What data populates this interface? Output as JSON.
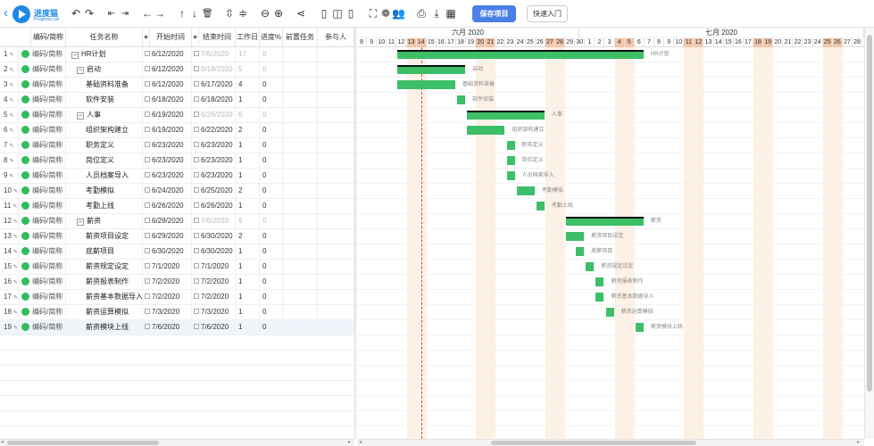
{
  "app": {
    "logo_title": "进度猫",
    "logo_subtitle": "Progress cat"
  },
  "toolbar": {
    "save_label": "保存项目",
    "quickstart_label": "快速入门",
    "icons": [
      "undo-icon",
      "redo-icon",
      "outdent-icon",
      "indent-icon",
      "move-left-icon",
      "move-right-icon",
      "move-up-icon",
      "move-down-icon",
      "delete-icon",
      "expand-all-icon",
      "collapse-all-icon",
      "zoom-out-icon",
      "zoom-in-icon",
      "critical-path-icon",
      "layout-grid-icon",
      "layout-both-icon",
      "layout-gantt-icon",
      "fullscreen-icon",
      "palette-icon",
      "members-icon",
      "print-icon",
      "download-icon",
      "excel-icon"
    ]
  },
  "columns": {
    "code": "编码/简称",
    "name": "任务名称",
    "start": "开始时间",
    "end": "结束时间",
    "workdays": "工作日",
    "progress": "进度%",
    "predecessor": "前置任务",
    "assignee": "参与人"
  },
  "gantt": {
    "month1": "六月 2020",
    "month2": "七月 2020"
  },
  "tasks": [
    {
      "num": "1",
      "code": "编码/简称",
      "name": "HR计划",
      "level": 0,
      "toggle": "−",
      "start": "6/12/2020",
      "end": "7/6/2020",
      "days": "17",
      "progress": "0",
      "summary": true
    },
    {
      "num": "2",
      "code": "编码/简称",
      "name": "启动",
      "level": 1,
      "toggle": "−",
      "start": "6/12/2020",
      "end": "6/18/2020",
      "days": "5",
      "progress": "0",
      "summary": true
    },
    {
      "num": "3",
      "code": "编码/简称",
      "name": "基础资料准备",
      "level": 2,
      "start": "6/12/2020",
      "end": "6/17/2020",
      "days": "4",
      "progress": "0"
    },
    {
      "num": "4",
      "code": "编码/简称",
      "name": "软件安装",
      "level": 2,
      "start": "6/18/2020",
      "end": "6/18/2020",
      "days": "1",
      "progress": "0"
    },
    {
      "num": "5",
      "code": "编码/简称",
      "name": "人事",
      "level": 1,
      "toggle": "−",
      "start": "6/19/2020",
      "end": "6/26/2020",
      "days": "6",
      "progress": "0",
      "summary": true
    },
    {
      "num": "6",
      "code": "编码/简称",
      "name": "组织架构建立",
      "level": 2,
      "start": "6/19/2020",
      "end": "6/22/2020",
      "days": "2",
      "progress": "0"
    },
    {
      "num": "7",
      "code": "编码/简称",
      "name": "职务定义",
      "level": 2,
      "start": "6/23/2020",
      "end": "6/23/2020",
      "days": "1",
      "progress": "0"
    },
    {
      "num": "8",
      "code": "编码/简称",
      "name": "岗位定义",
      "level": 2,
      "start": "6/23/2020",
      "end": "6/23/2020",
      "days": "1",
      "progress": "0"
    },
    {
      "num": "9",
      "code": "编码/简称",
      "name": "人员档案导入",
      "level": 2,
      "start": "6/23/2020",
      "end": "6/23/2020",
      "days": "1",
      "progress": "0"
    },
    {
      "num": "10",
      "code": "编码/简称",
      "name": "考勤模拟",
      "level": 2,
      "start": "6/24/2020",
      "end": "6/25/2020",
      "days": "2",
      "progress": "0"
    },
    {
      "num": "11",
      "code": "编码/简称",
      "name": "考勤上线",
      "level": 2,
      "start": "6/26/2020",
      "end": "6/26/2020",
      "days": "1",
      "progress": "0"
    },
    {
      "num": "12",
      "code": "编码/简称",
      "name": "薪资",
      "level": 1,
      "toggle": "−",
      "start": "6/29/2020",
      "end": "7/6/2020",
      "days": "6",
      "progress": "0",
      "summary": true
    },
    {
      "num": "13",
      "code": "编码/简称",
      "name": "薪资项目设定",
      "level": 2,
      "start": "6/29/2020",
      "end": "6/30/2020",
      "days": "2",
      "progress": "0"
    },
    {
      "num": "14",
      "code": "编码/简称",
      "name": "底薪项目",
      "level": 2,
      "start": "6/30/2020",
      "end": "6/30/2020",
      "days": "1",
      "progress": "0"
    },
    {
      "num": "15",
      "code": "编码/简称",
      "name": "薪资规定设定",
      "level": 2,
      "start": "7/1/2020",
      "end": "7/1/2020",
      "days": "1",
      "progress": "0"
    },
    {
      "num": "16",
      "code": "编码/简称",
      "name": "薪资报表制作",
      "level": 2,
      "start": "7/2/2020",
      "end": "7/2/2020",
      "days": "1",
      "progress": "0"
    },
    {
      "num": "17",
      "code": "编码/简称",
      "name": "薪资基本数据导入",
      "level": 2,
      "start": "7/2/2020",
      "end": "7/2/2020",
      "days": "1",
      "progress": "0"
    },
    {
      "num": "18",
      "code": "编码/简称",
      "name": "薪资运算模拟",
      "level": 2,
      "start": "7/3/2020",
      "end": "7/3/2020",
      "days": "1",
      "progress": "0"
    },
    {
      "num": "19",
      "code": "编码/简称",
      "name": "薪资模块上线",
      "level": 2,
      "start": "7/6/2020",
      "end": "7/6/2020",
      "days": "1",
      "progress": "0"
    }
  ],
  "bars": [
    {
      "start": "6/12/2020",
      "end": "7/6/2020"
    },
    {
      "start": "6/12/2020",
      "end": "6/18/2020"
    },
    {
      "start": "6/12/2020",
      "end": "6/17/2020"
    },
    {
      "start": "6/18/2020",
      "end": "6/18/2020"
    },
    {
      "start": "6/19/2020",
      "end": "6/26/2020"
    },
    {
      "start": "6/19/2020",
      "end": "6/22/2020"
    },
    {
      "start": "6/23/2020",
      "end": "6/23/2020"
    },
    {
      "start": "6/23/2020",
      "end": "6/23/2020"
    },
    {
      "start": "6/23/2020",
      "end": "6/23/2020"
    },
    {
      "start": "6/24/2020",
      "end": "6/25/2020"
    },
    {
      "start": "6/26/2020",
      "end": "6/26/2020"
    },
    {
      "start": "6/29/2020",
      "end": "7/6/2020"
    },
    {
      "start": "6/29/2020",
      "end": "6/30/2020"
    },
    {
      "start": "6/30/2020",
      "end": "6/30/2020"
    },
    {
      "start": "7/1/2020",
      "end": "7/1/2020"
    },
    {
      "start": "7/2/2020",
      "end": "7/2/2020"
    },
    {
      "start": "7/2/2020",
      "end": "7/2/2020"
    },
    {
      "start": "7/3/2020",
      "end": "7/3/2020"
    },
    {
      "start": "7/6/2020",
      "end": "7/6/2020"
    }
  ],
  "timeline": {
    "days": [
      "8",
      "9",
      "10",
      "11",
      "12",
      "13",
      "14",
      "15",
      "16",
      "17",
      "18",
      "19",
      "20",
      "21",
      "22",
      "23",
      "24",
      "25",
      "26",
      "27",
      "28",
      "29",
      "30",
      "1",
      "2",
      "3",
      "4",
      "5",
      "6",
      "7",
      "8",
      "9",
      "10",
      "11",
      "12",
      "13",
      "14",
      "15",
      "16",
      "17",
      "18",
      "19",
      "20",
      "21",
      "22",
      "23",
      "24",
      "25",
      "26",
      "27",
      "28"
    ],
    "weekend_idx": [
      5,
      6,
      12,
      13,
      19,
      20,
      26,
      27,
      33,
      34,
      40,
      41,
      47,
      48
    ],
    "today": "6/14/2020"
  },
  "colors": {
    "bar": "#3cbf67",
    "weekend": "#f4c7a8",
    "primary": "#4a7fe8"
  }
}
